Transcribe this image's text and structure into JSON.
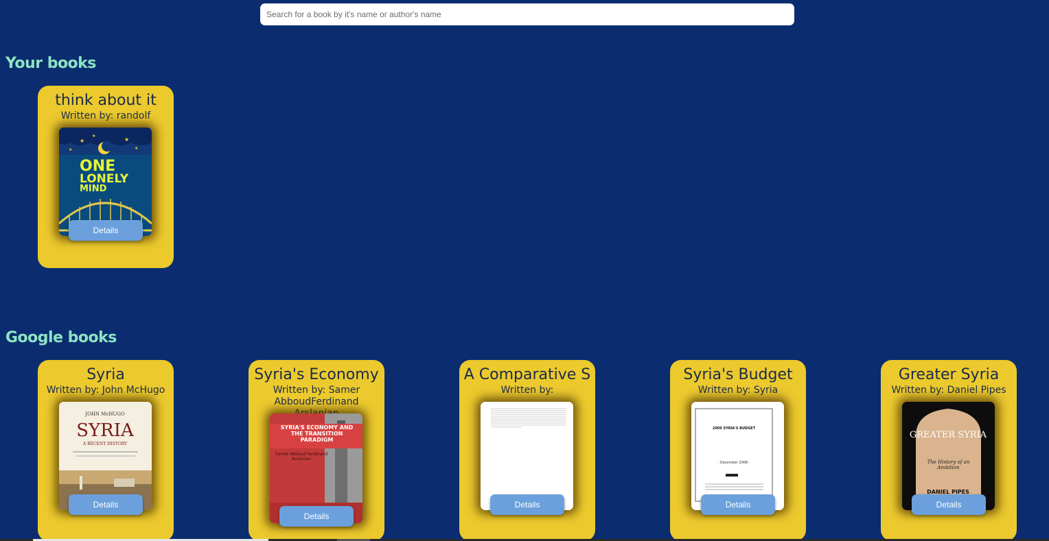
{
  "search": {
    "placeholder": "Search for a book by it's name or author's name",
    "value": ""
  },
  "sections": {
    "your_books": {
      "title": "Your books"
    },
    "google_books": {
      "title": "Google books"
    }
  },
  "your_books": [
    {
      "title": "think about it",
      "author": "Written by: randolf",
      "cover_text": [
        "ONE",
        "LONELY",
        "MIND"
      ],
      "details_label": "Details"
    }
  ],
  "google_books": [
    {
      "title": "Syria",
      "author": "Written by: John McHugo",
      "cover_author": "JOHN McHUGO",
      "cover_title": "SYRIA",
      "cover_subtitle": "A RECENT HISTORY",
      "details_label": "Details"
    },
    {
      "title": "Syria's Economy",
      "author": "Written by: Samer AbboudFerdinand Arslanian",
      "cover_title": "SYRIA'S ECONOMY AND THE TRANSITION PARADIGM",
      "cover_author": "Samer Abboud Ferdinand Arslanian",
      "details_label": "Details"
    },
    {
      "title": "A Comparative S",
      "author": "Written by:",
      "details_label": "Details"
    },
    {
      "title": "Syria's Budget",
      "author": "Written by: Syria",
      "cover_title": "2009 SYRIA'S BUDGET",
      "cover_date": "- December 2008 -",
      "details_label": "Details"
    },
    {
      "title": "Greater Syria",
      "author": "Written by: Daniel Pipes",
      "cover_title": "GREATER SYRIA",
      "cover_subtitle": "The History of an Ambition",
      "cover_author": "DANIEL PIPES",
      "details_label": "Details"
    }
  ],
  "colors": {
    "background": "#0b2d6f",
    "card": "#ecc92d",
    "section_title": "#8ee3c4",
    "button": "#6ba0dd"
  }
}
